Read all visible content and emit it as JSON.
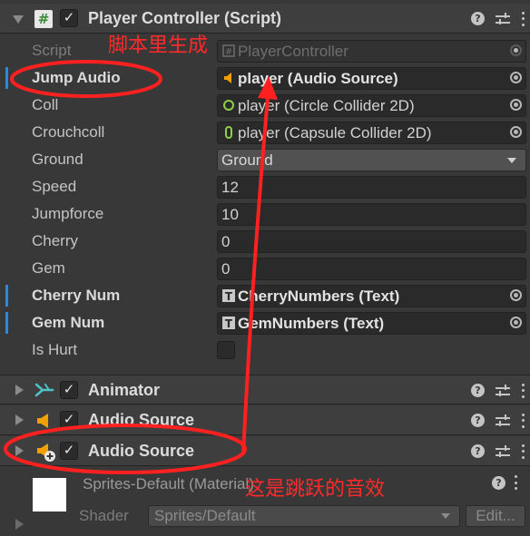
{
  "player_controller": {
    "title": "Player Controller (Script)",
    "icon": "script-hash-icon",
    "enabled": true,
    "fields": [
      {
        "label": "Script",
        "value": "PlayerController",
        "kind": "script"
      },
      {
        "label": "Jump Audio",
        "value": "player (Audio Source)",
        "kind": "object"
      },
      {
        "label": "Coll",
        "value": "player (Circle Collider 2D)",
        "kind": "object"
      },
      {
        "label": "Crouchcoll",
        "value": "player (Capsule Collider 2D)",
        "kind": "object"
      },
      {
        "label": "Ground",
        "value": "Ground",
        "kind": "dropdown"
      },
      {
        "label": "Speed",
        "value": "12",
        "kind": "number"
      },
      {
        "label": "Jumpforce",
        "value": "10",
        "kind": "number"
      },
      {
        "label": "Cherry",
        "value": "0",
        "kind": "number"
      },
      {
        "label": "Gem",
        "value": "0",
        "kind": "number"
      },
      {
        "label": "Cherry Num",
        "value": "CherryNumbers (Text)",
        "kind": "object"
      },
      {
        "label": "Gem Num",
        "value": "GemNumbers (Text)",
        "kind": "object"
      },
      {
        "label": "Is Hurt",
        "value": "",
        "kind": "toggle"
      }
    ]
  },
  "components": [
    {
      "title": "Animator",
      "icon": "animator-icon",
      "enabled": true
    },
    {
      "title": "Audio Source",
      "icon": "audio-source-icon",
      "enabled": true
    },
    {
      "title": "Audio Source",
      "icon": "audio-source-add-icon",
      "enabled": true
    }
  ],
  "material": {
    "name": "Sprites-Default (Material)",
    "shader_label": "Shader",
    "shader_value": "Sprites/Default",
    "edit_label": "Edit..."
  },
  "annotations": {
    "top": "脚本里生成",
    "bottom": "这是跳跃的音效"
  },
  "colors": {
    "annotation": "#ff2a2a",
    "modified_marker": "#2a8ad8",
    "background": "#383838"
  }
}
